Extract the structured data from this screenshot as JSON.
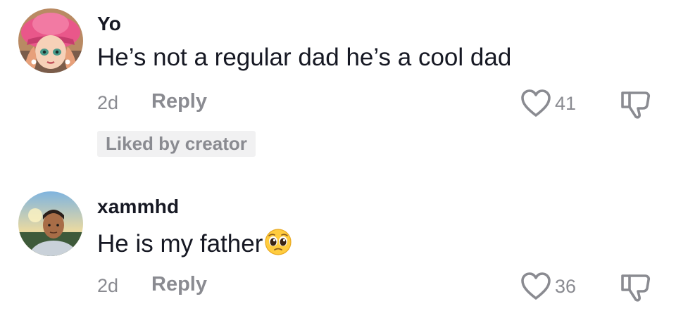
{
  "comments": [
    {
      "username": "Yo",
      "text": "He’s not a regular dad he’s a cool dad",
      "time": "2d",
      "reply_label": "Reply",
      "likes": "41",
      "badge": "Liked by creator"
    },
    {
      "username": "xammhd",
      "text": "He is my father",
      "emoji": "pleading-face",
      "time": "2d",
      "reply_label": "Reply",
      "likes": "36"
    }
  ],
  "colors": {
    "text_primary": "#161823",
    "text_secondary": "#8a8b91",
    "badge_bg": "#f1f1f2"
  }
}
